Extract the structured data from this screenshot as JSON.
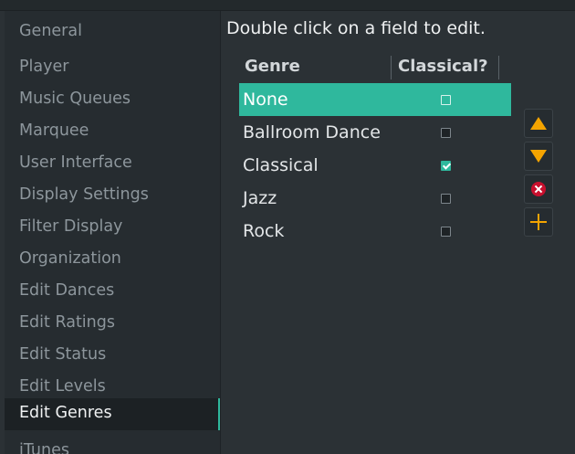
{
  "sidebar": {
    "items": [
      {
        "label": "General",
        "active": false
      },
      {
        "label": "Player",
        "active": false
      },
      {
        "label": "Music Queues",
        "active": false
      },
      {
        "label": "Marquee",
        "active": false
      },
      {
        "label": "User Interface",
        "active": false
      },
      {
        "label": "Display Settings",
        "active": false
      },
      {
        "label": "Filter Display",
        "active": false
      },
      {
        "label": "Organization",
        "active": false
      },
      {
        "label": "Edit Dances",
        "active": false
      },
      {
        "label": "Edit Ratings",
        "active": false
      },
      {
        "label": "Edit Status",
        "active": false
      },
      {
        "label": "Edit Levels",
        "active": false
      },
      {
        "label": "Edit Genres",
        "active": true
      },
      {
        "label": "iTunes",
        "active": false
      }
    ]
  },
  "main": {
    "instructions": "Double click on a field to edit.",
    "columns": {
      "genre": "Genre",
      "classical": "Classical?"
    },
    "rows": [
      {
        "genre": "None",
        "classical": false,
        "selected": true
      },
      {
        "genre": "Ballroom Dance",
        "classical": false,
        "selected": false
      },
      {
        "genre": "Classical",
        "classical": true,
        "selected": false
      },
      {
        "genre": "Jazz",
        "classical": false,
        "selected": false
      },
      {
        "genre": "Rock",
        "classical": false,
        "selected": false
      }
    ]
  },
  "buttons": {
    "icons": [
      "arrow-up-icon",
      "arrow-down-icon",
      "remove-icon",
      "add-icon"
    ]
  },
  "colors": {
    "accent": "#2fb89d",
    "button_icon": "#f5a400",
    "remove": "#c8102e"
  }
}
